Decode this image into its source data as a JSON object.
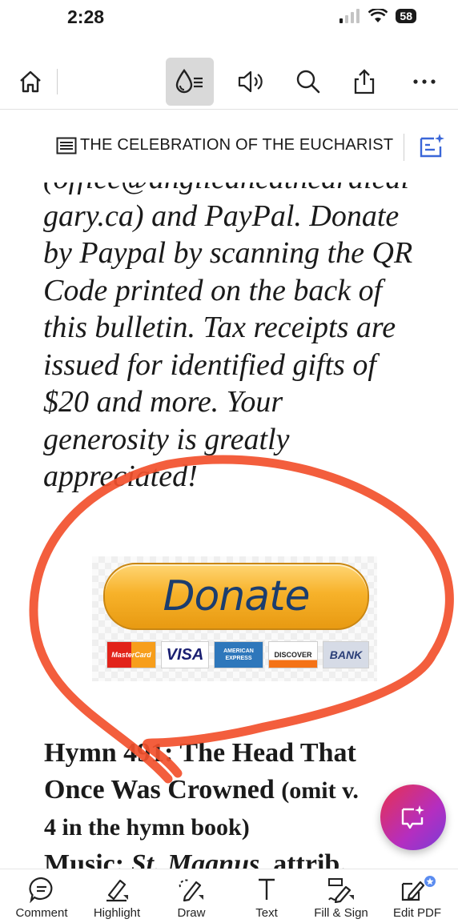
{
  "status_bar": {
    "time": "2:28",
    "battery": "58"
  },
  "toolbar": {
    "home": "home-icon",
    "liquid_mode": "liquid-mode-icon",
    "read_aloud": "speaker-icon",
    "search": "search-icon",
    "share": "share-icon",
    "more": "more-icon"
  },
  "document": {
    "title": "THE CELEBRATION OF THE EUCHARIST",
    "paragraph_lines": [
      "(office@anglicancathedralcal",
      "gary.ca) and PayPal. Donate",
      "by Paypal by scanning the QR",
      "Code printed on the back of",
      "this bulletin. Tax receipts are",
      "issued for identified gifts of",
      "$20 and more. Your",
      "generosity is greatly",
      "appreciated!"
    ],
    "donate_button": "Donate",
    "payment_cards": [
      "MasterCard",
      "VISA",
      "AMERICAN EXPRESS",
      "DISCOVER",
      "BANK"
    ],
    "hymn_title_line1": "Hymn 491: The Head That",
    "hymn_title_line2": "Once Was Crowned",
    "hymn_note_a": "(omit v.",
    "hymn_note_b": "4 in the hymn book)",
    "music_label": "Music:",
    "music_tune": "St. Magnus",
    "music_rest": ", attrib."
  },
  "bottom_bar": {
    "items": [
      {
        "label": "Comment",
        "icon": "comment-icon"
      },
      {
        "label": "Highlight",
        "icon": "highlight-icon"
      },
      {
        "label": "Draw",
        "icon": "draw-icon"
      },
      {
        "label": "Text",
        "icon": "text-icon"
      },
      {
        "label": "Fill & Sign",
        "icon": "fill-sign-icon"
      },
      {
        "label": "Edit PDF",
        "icon": "edit-pdf-icon"
      }
    ]
  },
  "colors": {
    "annotation_circle": "#f2502d",
    "fab_start": "#e8314f",
    "fab_end": "#7a3dd6",
    "donate_text": "#1b3d6e"
  }
}
